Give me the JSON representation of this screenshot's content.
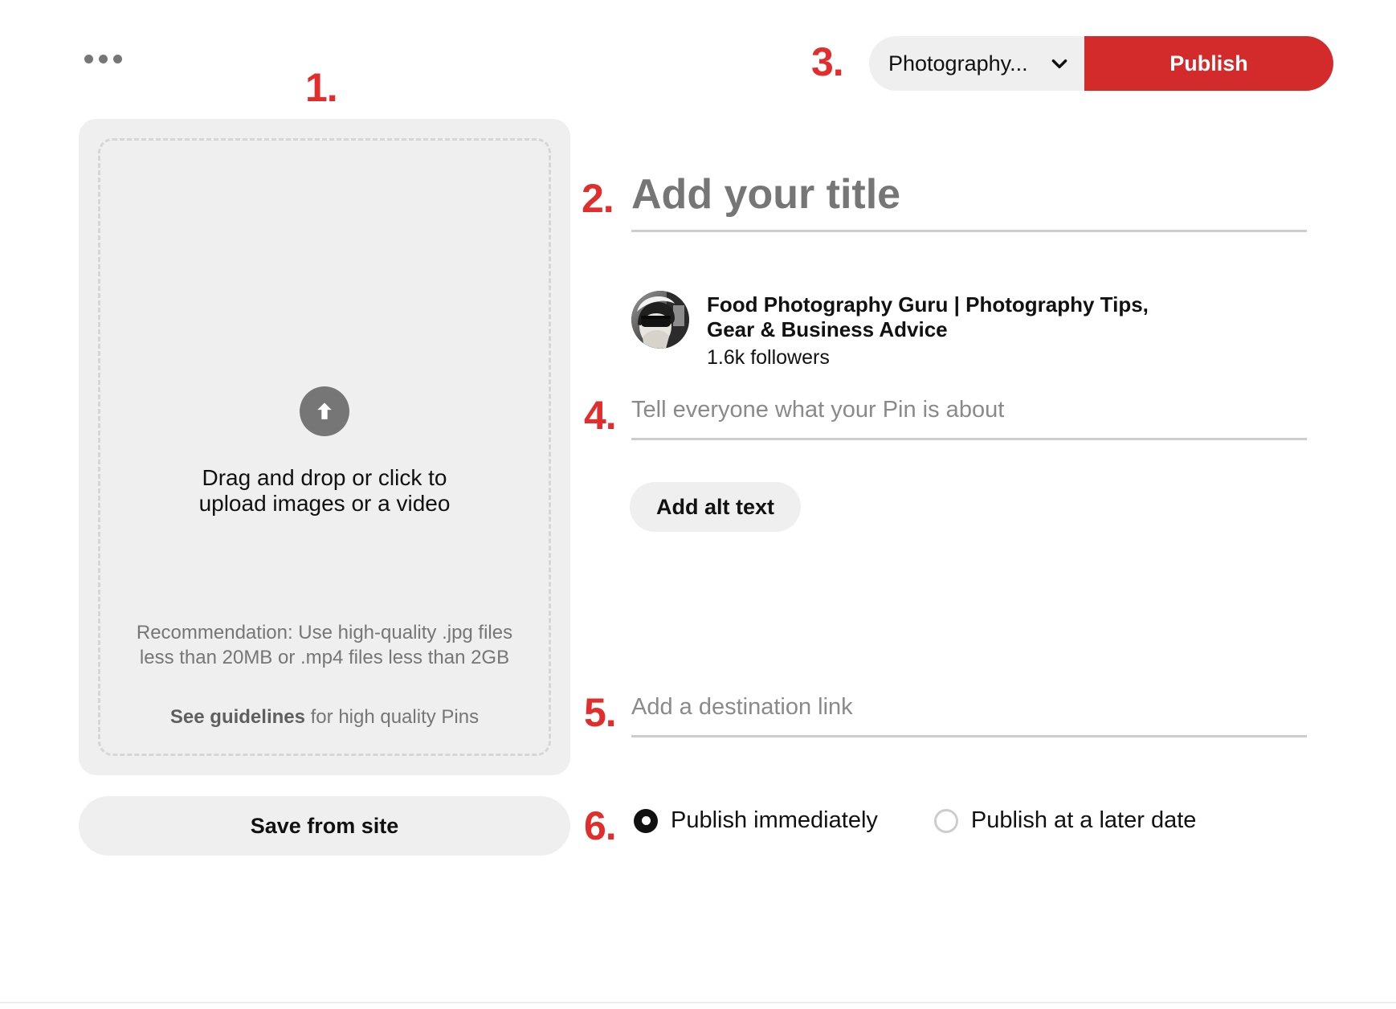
{
  "steps": {
    "one": "1.",
    "two": "2.",
    "three": "3.",
    "four": "4.",
    "five": "5.",
    "six": "6."
  },
  "colors": {
    "accent_red": "#d32b2b",
    "step_red": "#e22d2d",
    "panel_gray": "#efefef",
    "muted_text": "#767676",
    "underline": "#cdcdcd"
  },
  "topbar": {
    "overflow_icon": "kebab-menu-icon",
    "board_select_value": "Photography...",
    "board_select_chevron": "chevron-down-icon",
    "publish_label": "Publish"
  },
  "upload": {
    "icon": "upload-arrow-icon",
    "drag_line_1": "Drag and drop or click to",
    "drag_line_2": "upload images or a video",
    "recommendation": "Recommendation: Use high-quality .jpg files less than 20MB or .mp4 files less than 2GB",
    "guidelines_link": "See guidelines",
    "guidelines_rest": " for high quality Pins",
    "save_from_site_label": "Save from site"
  },
  "form": {
    "title_placeholder": "Add your title",
    "title_value": "",
    "description_placeholder": "Tell everyone what your Pin is about",
    "description_value": "",
    "alt_text_label": "Add alt text",
    "link_placeholder": "Add a destination link",
    "link_value": ""
  },
  "profile": {
    "avatar_icon": "user-avatar-photo",
    "name": "Food Photography Guru | Photography Tips, Gear & Business Advice",
    "followers": "1.6k followers"
  },
  "schedule": {
    "option_immediate": "Publish immediately",
    "option_later": "Publish at a later date",
    "selected": "Publish immediately"
  }
}
